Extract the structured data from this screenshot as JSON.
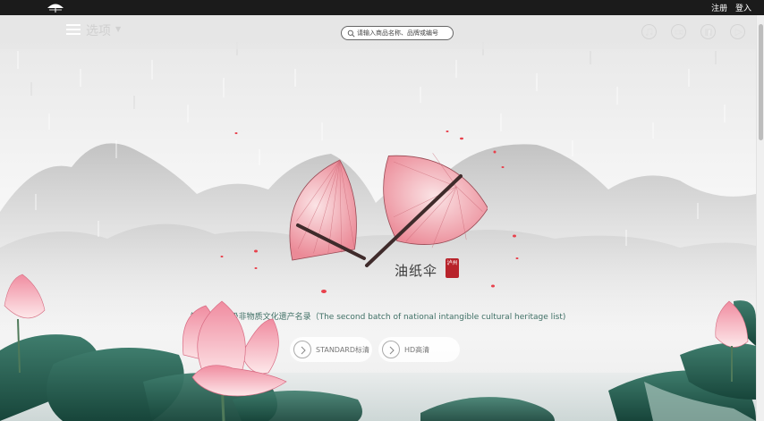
{
  "topbar": {
    "register": "注册",
    "login": "登入",
    "logo_icon": "umbrella-logo-icon"
  },
  "navbar": {
    "menu_label": "选项",
    "menu_caret": "▼",
    "search_placeholder": "请输入商品名称、品牌或编号",
    "icons": [
      "music-icon",
      "video-icon",
      "facebook-icon",
      "play-icon"
    ]
  },
  "hero": {
    "title": "油纸伞",
    "seal_text": "泸州",
    "subtitle": "第二批国家级非物质文化遗产名录（The second batch of national intangible cultural heritage list)"
  },
  "buttons": {
    "standard": "STANDARD标清",
    "hd": "HD高清"
  },
  "colors": {
    "topbar": "#1b1b1b",
    "accent_red": "#b8232b",
    "lotus_pink": "#f2a7b3",
    "leaf_green": "#2c6a5a",
    "subtitle_text": "#3f6f65"
  }
}
